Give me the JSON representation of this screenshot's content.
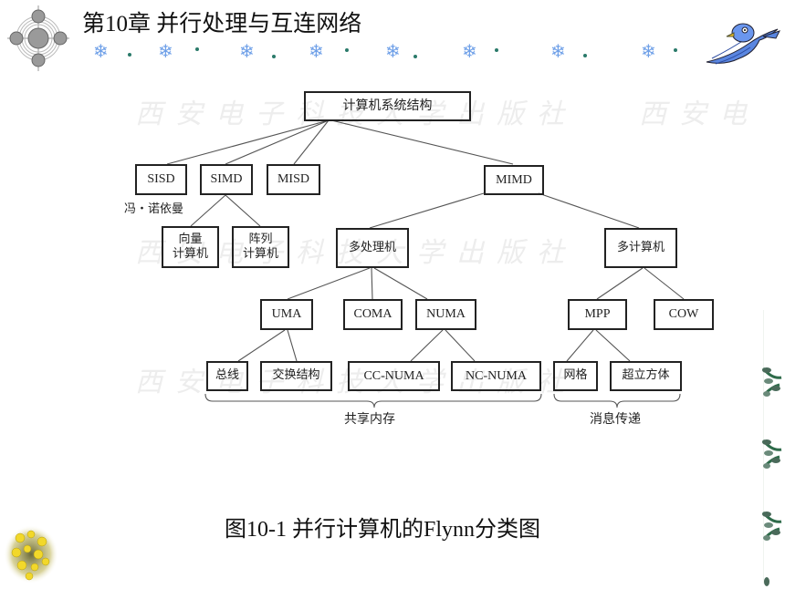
{
  "slide": {
    "title": "第10章  并行处理与互连网络",
    "caption": "图10-1  并行计算机的Flynn分类图",
    "watermark_row1": "西安电子科技大学出版社",
    "watermark_row1_right": "西安电",
    "watermark_row2": "西安电子科技大学出版社",
    "watermark_row3": "西安电子科技大学出版社",
    "decor": {
      "logo_icon": "target-cross-icon",
      "snowflake_icon": "snowflake-icon",
      "bird_icon": "bluebird-icon",
      "flowers_icon": "yellow-flowers-icon",
      "vine_icon": "vine-leaf-icon",
      "snowflake_count": 8,
      "vine_count": 4,
      "accent_snow": "#6fa0e8",
      "accent_bird": "#4a78d8",
      "accent_vine": "#2e6b4a"
    }
  },
  "diagram": {
    "root": "计算机系统结构",
    "nodes": {
      "sisd": "SISD",
      "simd": "SIMD",
      "misd": "MISD",
      "mimd": "MIMD",
      "vector": "向量\n计算机",
      "array": "阵列\n计算机",
      "multiprocessor": "多处理机",
      "multicomputer": "多计算机",
      "uma": "UMA",
      "coma": "COMA",
      "numa": "NUMA",
      "mpp": "MPP",
      "cow": "COW",
      "bus": "总线",
      "switch": "交换结构",
      "ccnuma": "CC-NUMA",
      "ncnuma": "NC-NUMA",
      "mesh": "网格",
      "hypercube": "超立方体"
    },
    "sisd_note": "冯・诺依曼",
    "brace_shared": "共享内存",
    "brace_message": "消息传递"
  }
}
